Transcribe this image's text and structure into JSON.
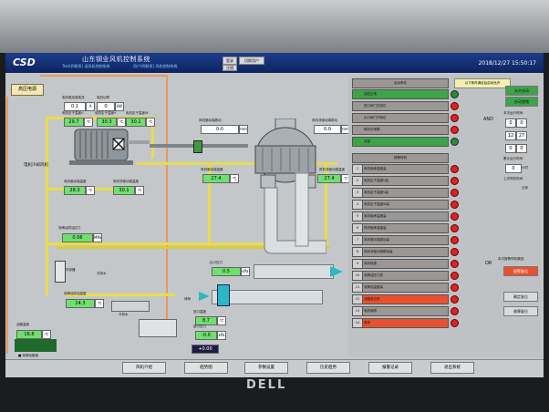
{
  "window": {
    "logo": "CSD",
    "system_title": "山东钢业风机控制系统",
    "subtitle_1": "Text(四联泵) 送风机控制系统",
    "subtitle_2": "用户(四联泵) 风机控制系统",
    "btn_login": "登录",
    "btn_switch_user": "切换用户",
    "btn_logout": "注销",
    "datetime": "2018/12/27 15:50:17"
  },
  "process": {
    "badge_high_voltage": "高压电源",
    "motor_label": "电机冷却风机",
    "cooler_label": "冷却器",
    "water_label": "冷却水",
    "cold_water_label": "冷却水",
    "ball_valve_label": "球阀",
    "slide_valve_label": "出口调节阀",
    "legend_oil": "■ 润滑油管道",
    "motor_current_label": "电机驱动端电流",
    "motor_current": "0.1",
    "motor_power_label": "电机功率",
    "motor_power": "0",
    "stator_u_label": "电机定子温度U",
    "stator_u": "29.7",
    "stator_v_label": "电机定子温度V",
    "stator_v": "30.3",
    "stator_w_label": "电机定子温度W",
    "stator_w": "30.1",
    "bearing_front_label": "电机驱动端温度",
    "bearing_front": "28.3",
    "bearing_rear_label": "电机非驱动端温度",
    "bearing_rear": "30.1",
    "vib_front_label": "风机驱动端振动",
    "vib_front": "0.0",
    "vib_rear_label": "风机非驱动端振动",
    "vib_rear": "0.0",
    "fan_bearing_front_label": "风机驱动端温度",
    "fan_bearing_front": "27.4",
    "fan_bearing_rear_label": "风机非驱动端温度",
    "fan_bearing_rear": "27.4",
    "oil_pressure_label": "润滑油供油压力",
    "oil_pressure": "0.06",
    "oil_temp_label": "润滑油供油温度",
    "oil_temp": "24.3",
    "tank_temp_label": "油箱温度",
    "tank_temp": "16.8",
    "outlet_pressure_label": "出口压力",
    "outlet_pressure": "0.5",
    "inlet_temp_label": "进口温度",
    "inlet_temp": "8.7",
    "inlet_pressure_label": "进口压力",
    "inlet_pressure": "-0.0",
    "valve_position": "+0.00",
    "unit_c": "℃",
    "unit_a": "A",
    "unit_kw": "kW",
    "unit_mm": "mm",
    "unit_mpa": "MPa",
    "unit_kpa": "kPa"
  },
  "interlock": {
    "ready_header": "启动条件",
    "ready_note": "以下条件满足后启动允许",
    "rows_ready": [
      {
        "n": "",
        "t": "油压正常"
      },
      {
        "n": "",
        "t": "进口阀门关到位"
      },
      {
        "n": "",
        "t": "出口阀门开到位"
      },
      {
        "n": "",
        "t": "电机无故障"
      },
      {
        "n": "",
        "t": "远控"
      }
    ],
    "trip_header": "报警停机",
    "rows_trip": [
      {
        "n": "1",
        "t": "电机轴承温度高"
      },
      {
        "n": "2",
        "t": "电机定子温度U高"
      },
      {
        "n": "3",
        "t": "电机定子温度V高"
      },
      {
        "n": "4",
        "t": "电机定子温度W高"
      },
      {
        "n": "5",
        "t": "风机轴承温度高"
      },
      {
        "n": "6",
        "t": "风机轴承温度高"
      },
      {
        "n": "7",
        "t": "风机驱动端振动高"
      },
      {
        "n": "8",
        "t": "风机非驱动端振动高"
      },
      {
        "n": "9",
        "t": "风机喘振"
      },
      {
        "n": "10",
        "t": "润滑油压力低"
      },
      {
        "n": "11",
        "t": "润滑油温度高"
      },
      {
        "n": "12",
        "t": "油箱液位低"
      },
      {
        "n": "13",
        "t": "电机故障"
      },
      {
        "n": "14",
        "t": "急停"
      }
    ],
    "and_label": "AND",
    "or_label": "OR",
    "start_allow": "允许启动",
    "start_ready": "启动就绪",
    "run_time_label": "本次运行时间:",
    "hours_label": "小时",
    "minutes_label": "分钟",
    "time_1": "0",
    "time_2": "0",
    "time_3": "12",
    "time_4": "27",
    "time_5": "0",
    "time_6": "0",
    "total_run_label": "累计运行时间:",
    "total_hours": "0",
    "stop_time_label": "上次停机时间:",
    "run_label": "本次报警停机原因:",
    "alarm_btn": "报警复位",
    "confirm_btn": "确定复位",
    "reset_btn": "故障复位"
  },
  "bottom_nav": {
    "tabs": [
      "风机介绍",
      "趋势图",
      "参数设置",
      "历史趋势",
      "报警记录",
      "退出系统"
    ]
  },
  "monitor_brand": "DELL"
}
